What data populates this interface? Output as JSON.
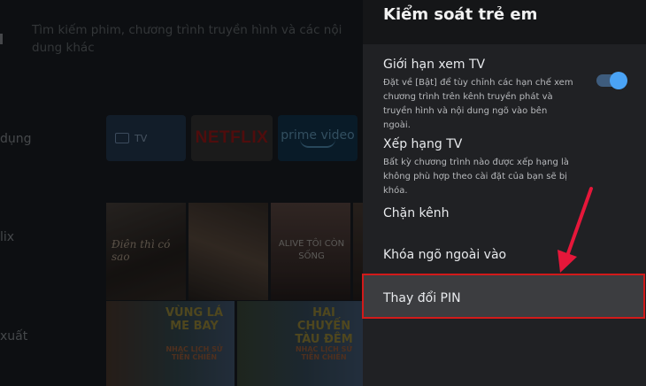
{
  "background": {
    "search_hint": "Tìm kiếm phim, chương trình truyền hình và các nội dung khác",
    "sidebar": [
      "dụng",
      "lix",
      "xuất"
    ],
    "apps": {
      "tv": "TV",
      "netflix": "NETFLIX",
      "prime": "prime video"
    },
    "row1": [
      {
        "caption": "Điên thì có sao"
      },
      {
        "caption": ""
      },
      {
        "caption": "ALIVE TÔI CÒN SỐNG"
      },
      {
        "caption": ""
      }
    ],
    "row2": [
      {
        "title": "VÙNG LÁ ME BAY",
        "sub": "NHẠC LỊCH SỬ TIỀN CHIẾN"
      },
      {
        "title": "HAI CHUYẾN TÀU ĐÊM",
        "sub": "NHẠC LỊCH SỬ TIỀN CHIẾN"
      }
    ]
  },
  "panel": {
    "title": "Kiểm soát trẻ em",
    "items": [
      {
        "title": "Giới hạn xem TV",
        "description": "Đặt về [Bật] để tùy chỉnh các hạn chế xem chương trình trên kênh truyền phát và truyền hình và nội dung ngõ vào bên ngoài."
      },
      {
        "title": "Xếp hạng TV",
        "description": "Bất kỳ chương trình nào được xếp hạng là không phù hợp theo cài đặt của bạn sẽ bị khóa."
      },
      {
        "title": "Chặn kênh"
      },
      {
        "title": "Khóa ngõ ngoài vào"
      },
      {
        "title": "Thay đổi PIN"
      }
    ],
    "toggle_state": "on"
  },
  "colors": {
    "accent": "#4aa3f5",
    "highlight_border": "#d11a1a",
    "annotation_arrow": "#e6173a"
  }
}
